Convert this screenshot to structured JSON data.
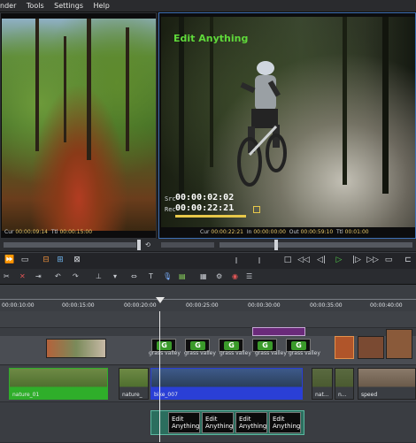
{
  "menu": {
    "items": [
      "nder",
      "Tools",
      "Settings",
      "Help"
    ]
  },
  "source": {
    "cur_label": "Cur",
    "cur_time": "00:00:09:14",
    "ttl_label": "Ttl",
    "ttl_time": "00:00:15:00"
  },
  "record": {
    "overlay_title": "Edit Anything",
    "src_label": "Src",
    "src_time": "00:00:02:02",
    "rec_label": "Rec",
    "rec_time": "00:00:22:21",
    "cur_label": "Cur",
    "cur_time": "00:00:22:21",
    "in_label": "In",
    "in_time": "00:00:00:00",
    "out_label": "Out",
    "out_time": "00:00:59:10",
    "ttl_label": "Ttl",
    "ttl_time": "00:01:00"
  },
  "transport": {
    "left_buttons": [
      "⏩",
      "▭",
      "⊟",
      "⊞",
      "⊠"
    ],
    "right_buttons": [
      "□",
      "◁◁",
      "◁|",
      "▷",
      "|▷",
      "▷▷",
      "▭",
      "⊏"
    ]
  },
  "ruler": {
    "labels": [
      "00:00:10:00",
      "00:00:15:00",
      "00:00:20:00",
      "00:00:25:00",
      "00:00:30:00",
      "00:00:35:00",
      "00:00:40:00"
    ]
  },
  "tracks": {
    "video_clips": [
      {
        "label": "nature_01"
      },
      {
        "label": "nature_"
      },
      {
        "label": "bike_007"
      },
      {
        "label": "nat..."
      },
      {
        "label": "n..."
      },
      {
        "label": "speed"
      }
    ],
    "transition_text": [
      "grass valley",
      "grass valley",
      "grass valley",
      "grass valley",
      "grass valley"
    ],
    "title_clips": [
      "Edit Anything",
      "Edit Anything",
      "Edit Anything",
      "Edit Anything"
    ]
  },
  "colors": {
    "accent_blue": "#3d6fb3",
    "clip_green": "#2fae2a",
    "clip_blue": "#2a3fd6",
    "overlay_title_green": "#5fd93a",
    "rec_bar_yellow": "#e7c84a"
  }
}
